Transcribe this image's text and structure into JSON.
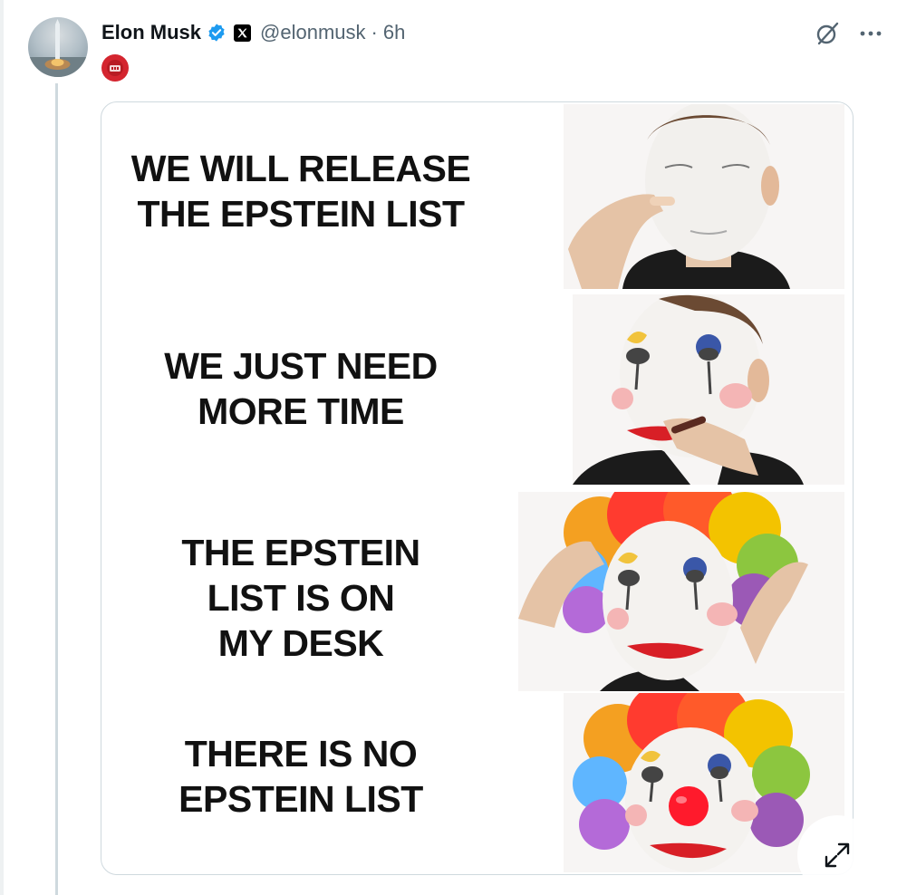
{
  "tweet": {
    "display_name": "Elon Musk",
    "handle": "@elonmusk",
    "separator": "·",
    "time": "6h"
  },
  "meme": {
    "panels": [
      {
        "lines": [
          "WE WILL RELEASE",
          "THE EPSTEIN LIST"
        ]
      },
      {
        "lines": [
          "WE JUST NEED",
          "MORE TIME"
        ]
      },
      {
        "lines": [
          "THE EPSTEIN",
          "LIST IS ON",
          "MY DESK"
        ]
      },
      {
        "lines": [
          "THERE IS NO",
          "EPSTEIN LIST"
        ]
      }
    ]
  },
  "icons": {
    "verified": "verified-badge-icon",
    "affiliation": "x-logo-icon",
    "grok": "grok-icon",
    "more": "more-options-icon",
    "expand": "expand-icon",
    "sub_badge": "community-badge-icon"
  },
  "colors": {
    "verified_blue": "#1d9bf0",
    "text_secondary": "#536471",
    "border": "#cfd9de"
  }
}
